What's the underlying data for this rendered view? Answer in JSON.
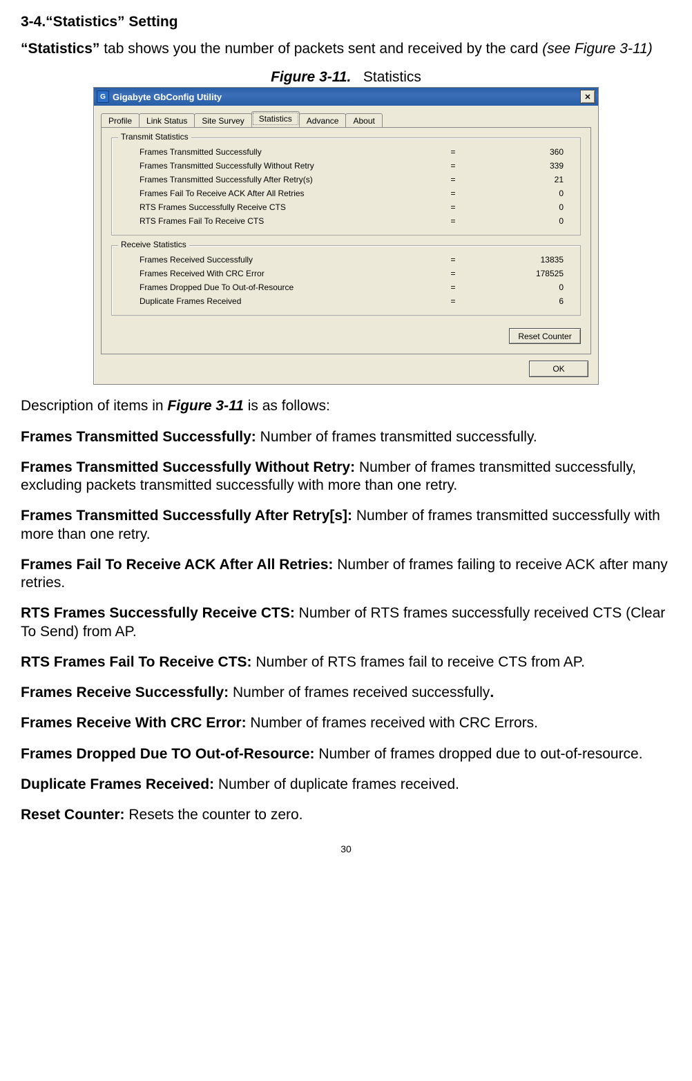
{
  "heading": "3-4.“Statistics” Setting",
  "intro": {
    "before": "“Statistics”",
    "middle": " tab shows you the number of packets sent and received by the card ",
    "ital": "(see Figure 3-11)"
  },
  "figure_caption": {
    "label": "Figure 3-11.",
    "gap": "   ",
    "text": "Statistics"
  },
  "dialog": {
    "title": "Gigabyte GbConfig Utility",
    "icon_text": "G",
    "close_glyph": "✕",
    "tabs": [
      "Profile",
      "Link Status",
      "Site Survey",
      "Statistics",
      "Advance",
      "About"
    ],
    "active_tab_index": 3,
    "transmit_title": "Transmit Statistics",
    "receive_title": "Receive Statistics",
    "transmit_rows": [
      {
        "label": "Frames Transmitted Successfully",
        "val": "360"
      },
      {
        "label": "Frames Transmitted Successfully  Without Retry",
        "val": "339"
      },
      {
        "label": "Frames Transmitted Successfully After Retry(s)",
        "val": "21"
      },
      {
        "label": "Frames Fail To Receive ACK After All Retries",
        "val": "0"
      },
      {
        "label": "RTS Frames Successfully Receive CTS",
        "val": "0"
      },
      {
        "label": "RTS Frames Fail To Receive CTS",
        "val": "0"
      }
    ],
    "receive_rows": [
      {
        "label": "Frames Received Successfully",
        "val": "13835"
      },
      {
        "label": "Frames Received With CRC Error",
        "val": "178525"
      },
      {
        "label": "Frames Dropped Due To Out-of-Resource",
        "val": "0"
      },
      {
        "label": "Duplicate Frames Received",
        "val": "6"
      }
    ],
    "reset_btn": "Reset Counter",
    "ok_btn": "OK"
  },
  "desc_intro": {
    "before": "Description of items in ",
    "figref": "Figure 3-11",
    "after": " is as follows:"
  },
  "descriptions": [
    {
      "term": "Frames Transmitted Successfully:",
      "text": " Number of frames transmitted successfully."
    },
    {
      "term": "Frames Transmitted Successfully Without Retry:",
      "text": " Number of frames transmitted successfully, excluding packets transmitted successfully with more than one retry."
    },
    {
      "term": "Frames Transmitted Successfully After Retry[s]:",
      "text": " Number of frames transmitted successfully with more than one retry."
    },
    {
      "term": "Frames Fail To Receive ACK After All Retries:",
      "text": " Number of frames failing to receive ACK after many retries."
    },
    {
      "term": "RTS Frames Successfully Receive CTS:",
      "text": " Number of RTS frames successfully received CTS (Clear To Send) from AP."
    },
    {
      "term": "RTS Frames Fail To Receive CTS:",
      "text": " Number of RTS frames fail to receive CTS from AP."
    },
    {
      "term": "Frames Receive Successfully:",
      "text": " Number of frames received successfully",
      "trailing_bold": "."
    },
    {
      "term": "Frames Receive With CRC Error:",
      "text": " Number of frames received with CRC Errors."
    },
    {
      "term": "Frames Dropped Due TO Out-of-Resource:",
      "text": " Number of frames dropped due to out-of-resource."
    },
    {
      "term": "Duplicate Frames Received:",
      "text": " Number of duplicate frames received."
    },
    {
      "term": "Reset Counter:",
      "text": " Resets the counter to zero."
    }
  ],
  "page_number": "30"
}
